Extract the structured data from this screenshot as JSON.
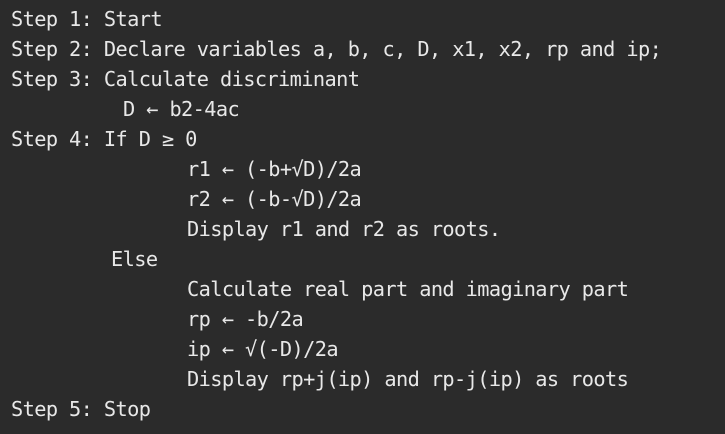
{
  "lines": [
    "Step 1: Start",
    "Step 2: Declare variables a, b, c, D, x1, x2, rp and ip;",
    "Step 3: Calculate discriminant",
    "D ← b2-4ac",
    "Step 4: If D ≥ 0",
    "r1 ← (-b+√D)/2a",
    "r2 ← (-b-√D)/2a",
    "Display r1 and r2 as roots.",
    "Else",
    "Calculate real part and imaginary part",
    "rp ← -b/2a",
    "ip ← √(-D)/2a",
    "Display rp+j(ip) and rp-j(ip) as roots",
    "Step 5: Stop"
  ]
}
